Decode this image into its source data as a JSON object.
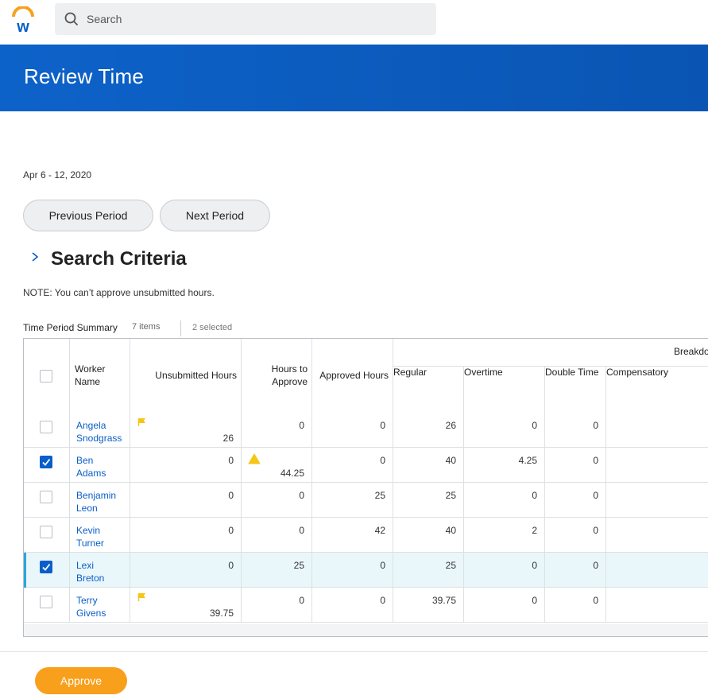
{
  "header": {
    "search_placeholder": "Search",
    "page_title": "Review Time"
  },
  "period": {
    "date_range": "Apr 6 - 12, 2020",
    "previous_label": "Previous Period",
    "next_label": "Next Period"
  },
  "search_criteria": {
    "title": "Search Criteria"
  },
  "note": "NOTE: You can’t approve unsubmitted hours.",
  "summary": {
    "title": "Time Period Summary",
    "item_count": "7 items",
    "selected_count": "2 selected"
  },
  "table": {
    "headers": {
      "worker_name": "Worker Name",
      "unsubmitted": "Unsubmitted Hours",
      "to_approve": "Hours to Approve",
      "approved": "Approved Hours",
      "breakdown": "Breakdown",
      "regular": "Regular",
      "overtime": "Overtime",
      "double_time": "Double Time",
      "compensatory": "Compensatory"
    },
    "rows": [
      {
        "first": "Angela",
        "last": "Snodgrass",
        "checked": false,
        "unsubmitted": "26",
        "unsubmitted_flag": true,
        "to_approve": "0",
        "to_approve_warning": false,
        "approved": "0",
        "regular": "26",
        "overtime": "0",
        "double_time": "0",
        "selected": false
      },
      {
        "first": "Ben",
        "last": "Adams",
        "checked": true,
        "unsubmitted": "0",
        "unsubmitted_flag": false,
        "to_approve": "44.25",
        "to_approve_warning": true,
        "approved": "0",
        "regular": "40",
        "overtime": "4.25",
        "double_time": "0",
        "selected": false
      },
      {
        "first": "Benjamin",
        "last": "Leon",
        "checked": false,
        "unsubmitted": "0",
        "unsubmitted_flag": false,
        "to_approve": "0",
        "to_approve_warning": false,
        "approved": "25",
        "regular": "25",
        "overtime": "0",
        "double_time": "0",
        "selected": false
      },
      {
        "first": "Kevin",
        "last": "Turner",
        "checked": false,
        "unsubmitted": "0",
        "unsubmitted_flag": false,
        "to_approve": "0",
        "to_approve_warning": false,
        "approved": "42",
        "regular": "40",
        "overtime": "2",
        "double_time": "0",
        "selected": false
      },
      {
        "first": "Lexi",
        "last": "Breton",
        "checked": true,
        "unsubmitted": "0",
        "unsubmitted_flag": false,
        "to_approve": "25",
        "to_approve_warning": false,
        "approved": "0",
        "regular": "25",
        "overtime": "0",
        "double_time": "0",
        "selected": true
      },
      {
        "first": "Terry",
        "last": "Givens",
        "checked": false,
        "unsubmitted": "39.75",
        "unsubmitted_flag": true,
        "to_approve": "0",
        "to_approve_warning": false,
        "approved": "0",
        "regular": "39.75",
        "overtime": "0",
        "double_time": "0",
        "selected": false
      }
    ]
  },
  "actions": {
    "approve_label": "Approve"
  },
  "colors": {
    "brand_blue": "#0a5ec9",
    "approve_orange": "#f8a01b",
    "flag_yellow": "#f5c518",
    "selected_row": "#eaf7fa"
  },
  "icons": [
    "workday-logo",
    "search-icon",
    "chevron-right-icon",
    "flag-icon",
    "warning-icon",
    "checkbox"
  ]
}
